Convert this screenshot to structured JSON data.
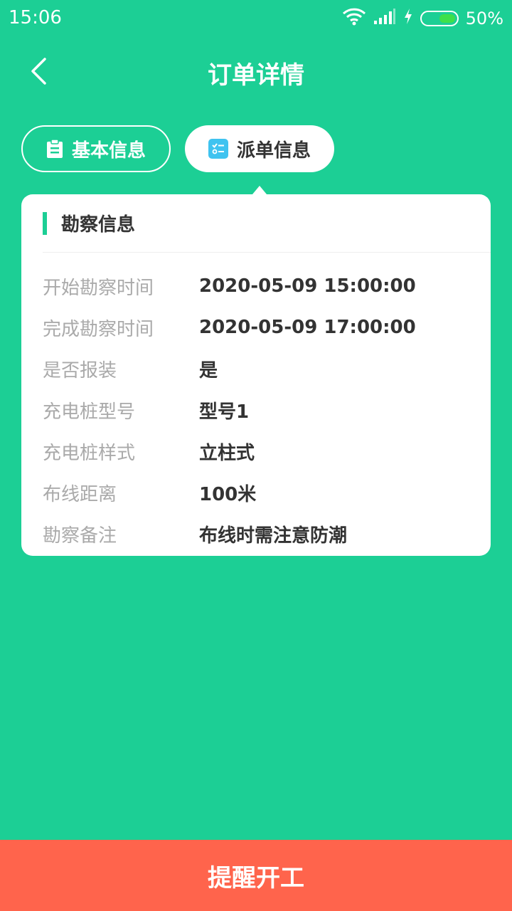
{
  "status_bar": {
    "time": "15:06",
    "battery_text": "50%",
    "battery_level": 0.5
  },
  "header": {
    "title": "订单详情"
  },
  "tabs": [
    {
      "label": "基本信息",
      "icon": "clipboard-icon",
      "active": false
    },
    {
      "label": "派单信息",
      "icon": "checklist-icon",
      "active": true
    }
  ],
  "card": {
    "title": "勘察信息",
    "rows": [
      {
        "label": "开始勘察时间",
        "value": "2020-05-09 15:00:00"
      },
      {
        "label": "完成勘察时间",
        "value": "2020-05-09 17:00:00"
      },
      {
        "label": "是否报装",
        "value": "是"
      },
      {
        "label": "充电桩型号",
        "value": "型号1"
      },
      {
        "label": "充电桩样式",
        "value": "立柱式"
      },
      {
        "label": "布线距离",
        "value": "100米"
      },
      {
        "label": "勘察备注",
        "value": "布线时需注意防潮"
      }
    ]
  },
  "footer": {
    "button_label": "提醒开工"
  },
  "colors": {
    "primary": "#1ccf95",
    "action": "#ff644c",
    "tab_icon": "#3fc3f0"
  }
}
